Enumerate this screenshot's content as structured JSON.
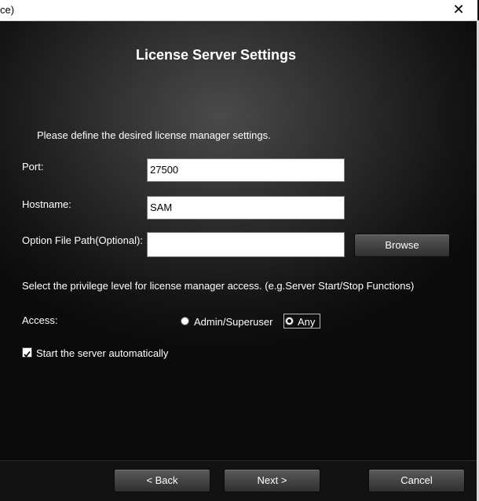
{
  "window": {
    "title": "ce)"
  },
  "page": {
    "heading": "License Server Settings",
    "intro": "Please define the desired license manager settings."
  },
  "fields": {
    "port": {
      "label": "Port:",
      "value": "27500"
    },
    "hostname": {
      "label": "Hostname:",
      "value": "SAM"
    },
    "option_file": {
      "label": "Option File Path(Optional):",
      "value": "",
      "browse": "Browse"
    }
  },
  "privilege": {
    "prompt": "Select the privilege level for license manager access. (e.g.Server Start/Stop Functions)",
    "access_label": "Access:",
    "options": [
      "Admin/Superuser",
      "Any"
    ],
    "selected": "Any"
  },
  "autostart": {
    "label": "Start the server automatically",
    "checked": true
  },
  "footer": {
    "back": "< Back",
    "next": "Next >",
    "cancel": "Cancel"
  },
  "icons": {
    "close": "close-icon",
    "check": "checkmark-icon"
  }
}
